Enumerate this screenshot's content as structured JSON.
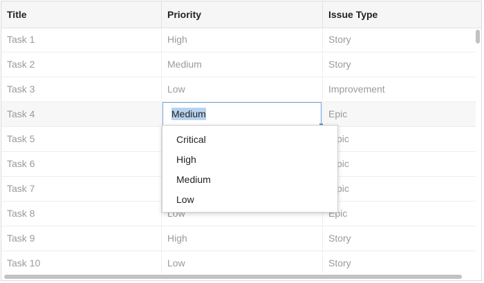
{
  "columns": [
    "Title",
    "Priority",
    "Issue Type"
  ],
  "rows": [
    {
      "title": "Task 1",
      "priority": "High",
      "type": "Story"
    },
    {
      "title": "Task 2",
      "priority": "Medium",
      "type": "Story"
    },
    {
      "title": "Task 3",
      "priority": "Low",
      "type": "Improvement"
    },
    {
      "title": "Task 4",
      "priority": "Medium",
      "type": "Epic"
    },
    {
      "title": "Task 5",
      "priority": "",
      "type": "pic"
    },
    {
      "title": "Task 6",
      "priority": "",
      "type": "pic"
    },
    {
      "title": "Task 7",
      "priority": "",
      "type": "pic"
    },
    {
      "title": "Task 8",
      "priority": "Low",
      "type": "Epic"
    },
    {
      "title": "Task 9",
      "priority": "High",
      "type": "Story"
    },
    {
      "title": "Task 10",
      "priority": "Low",
      "type": "Story"
    }
  ],
  "editor": {
    "value": "Medium"
  },
  "dropdown": {
    "options": [
      "Critical",
      "High",
      "Medium",
      "Low"
    ]
  },
  "colors": {
    "accent": "#6aa6d9",
    "selection": "#b7d3f0",
    "header_bg": "#f6f6f6"
  }
}
